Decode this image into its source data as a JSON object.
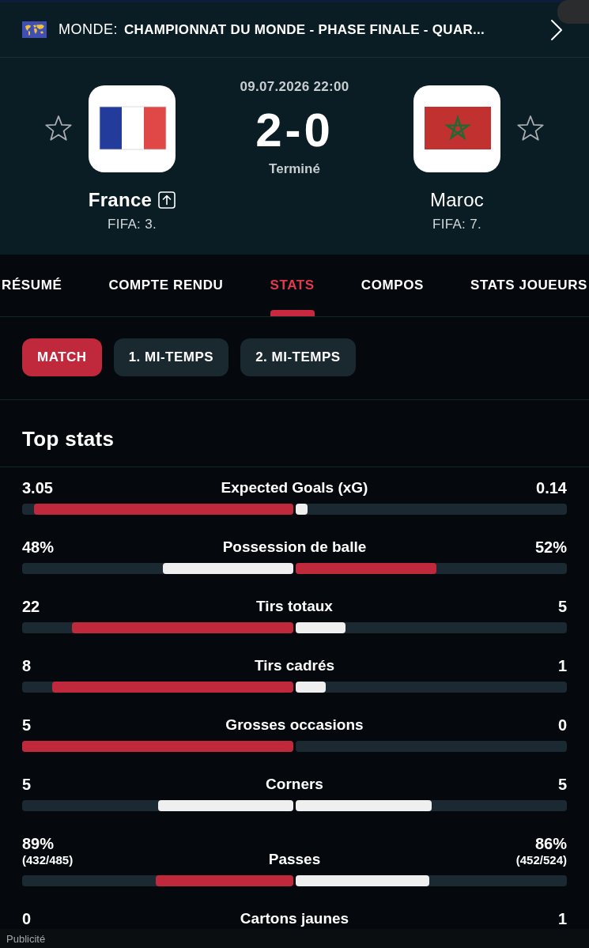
{
  "header": {
    "region": "MONDE:",
    "competition": "CHAMPIONNAT DU MONDE - PHASE FINALE - QUAR..."
  },
  "match": {
    "date": "09.07.2026 22:00",
    "score": "2-0",
    "status": "Terminé"
  },
  "teams": [
    {
      "name": "France",
      "rank": "FIFA: 3.",
      "kind": "tricolor",
      "favorite": false,
      "winner": true,
      "advanced": true
    },
    {
      "name": "Maroc",
      "rank": "FIFA: 7.",
      "kind": "pentagram",
      "favorite": false,
      "winner": false,
      "advanced": false
    }
  ],
  "tabs": [
    {
      "label": "RÉSUMÉ",
      "selected": false
    },
    {
      "label": "COMPTE RENDU",
      "selected": false
    },
    {
      "label": "STATS",
      "selected": true
    },
    {
      "label": "COMPOS",
      "selected": false
    },
    {
      "label": "STATS JOUEURS",
      "selected": false
    }
  ],
  "periods": [
    {
      "label": "MATCH",
      "selected": true
    },
    {
      "label": "1. MI-TEMPS",
      "selected": false
    },
    {
      "label": "2. MI-TEMPS",
      "selected": false
    }
  ],
  "section_title": "Top stats",
  "stats": [
    {
      "label": "Expected Goals (xG)",
      "home": {
        "value": "3.05",
        "level": 0.956,
        "highlighted": true
      },
      "away": {
        "value": "0.14",
        "level": 0.044,
        "highlighted": false
      }
    },
    {
      "label": "Possession de balle",
      "home": {
        "value": "48%",
        "level": 0.48,
        "highlighted": false
      },
      "away": {
        "value": "52%",
        "level": 0.52,
        "highlighted": true
      }
    },
    {
      "label": "Tirs totaux",
      "home": {
        "value": "22",
        "level": 0.815,
        "highlighted": true
      },
      "away": {
        "value": "5",
        "level": 0.185,
        "highlighted": false
      }
    },
    {
      "label": "Tirs cadrés",
      "home": {
        "value": "8",
        "level": 0.889,
        "highlighted": true
      },
      "away": {
        "value": "1",
        "level": 0.111,
        "highlighted": false
      }
    },
    {
      "label": "Grosses occasions",
      "home": {
        "value": "5",
        "level": 1,
        "highlighted": true
      },
      "away": {
        "value": "0"
      }
    },
    {
      "label": "Corners",
      "home": {
        "value": "5",
        "level": 0.5,
        "highlighted": false
      },
      "away": {
        "value": "5",
        "level": 0.5,
        "highlighted": false
      }
    },
    {
      "label": "Passes",
      "home": {
        "value": "89%",
        "detail": "(432/485)",
        "level": 0.507,
        "highlighted": true
      },
      "away": {
        "value": "86%",
        "detail": "(452/524)",
        "level": 0.493,
        "highlighted": false
      }
    },
    {
      "label": "Cartons jaunes",
      "home": {
        "value": "0"
      },
      "away": {
        "value": "1"
      }
    }
  ],
  "ad_label": "Publicité"
}
